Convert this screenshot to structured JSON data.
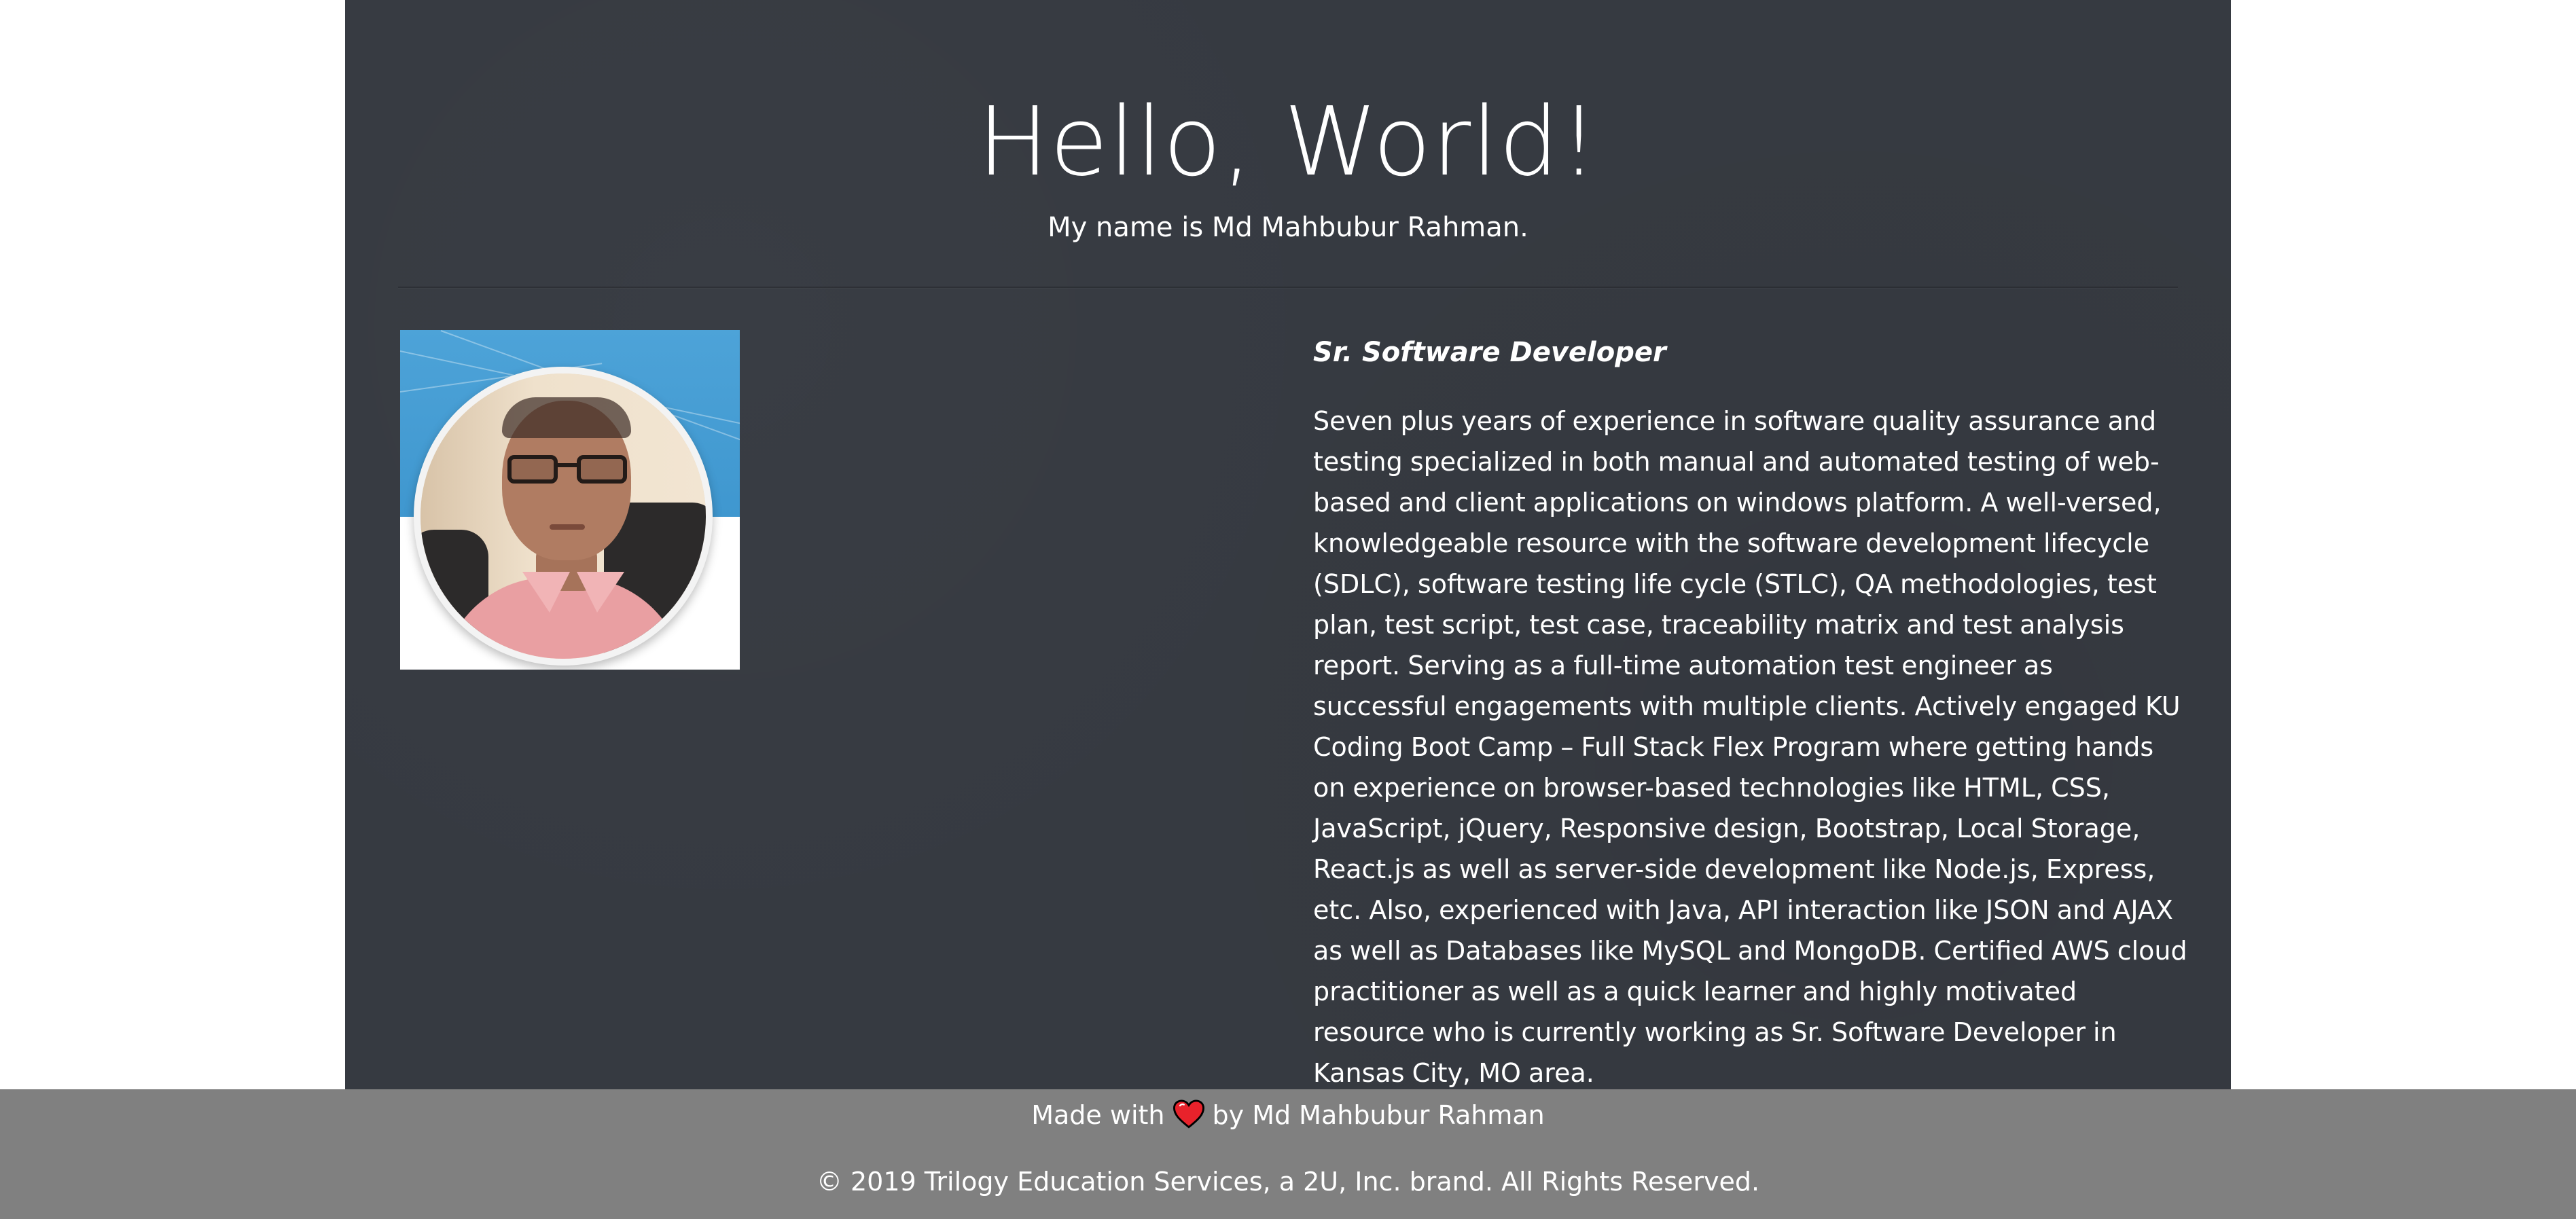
{
  "hero": {
    "title": "Hello, World!",
    "subtitle": "My name is Md Mahbubur Rahman."
  },
  "profile": {
    "photo_icon": "profile-photo",
    "job_title": "Sr. Software Developer",
    "bio": "Seven plus years of experience in software quality assurance and testing specialized in both manual and automated testing of web-based and client applications on windows platform. A well-versed, knowledgeable resource with the software development lifecycle (SDLC), software testing life cycle (STLC), QA methodologies, test plan, test script, test case, traceability matrix and test analysis report. Serving as a full-time automation test engineer as successful engagements with multiple clients. Actively engaged KU Coding Boot Camp – Full Stack Flex Program where getting hands on experience on browser-based technologies like HTML, CSS, JavaScript, jQuery, Responsive design, Bootstrap, Local Storage, React.js as well as server-side development like Node.js, Express, etc. Also, experienced with Java, API interaction like JSON and AJAX as well as Databases like MySQL and MongoDB. Certified AWS cloud practitioner as well as a quick learner and highly motivated resource who is currently working as Sr. Software Developer in Kansas City, MO area."
  },
  "footer": {
    "made_with_prefix": "Made with",
    "heart_icon": "heart-icon",
    "made_with_suffix": "by Md Mahbubur Rahman",
    "copyright": "© 2019 Trilogy Education Services, a 2U, Inc. brand. All Rights Reserved."
  },
  "colors": {
    "page_background": "#ffffff",
    "container_background": "#363a41",
    "footer_background": "#808080",
    "text": "#ffffff",
    "heart": "#e8222b"
  }
}
